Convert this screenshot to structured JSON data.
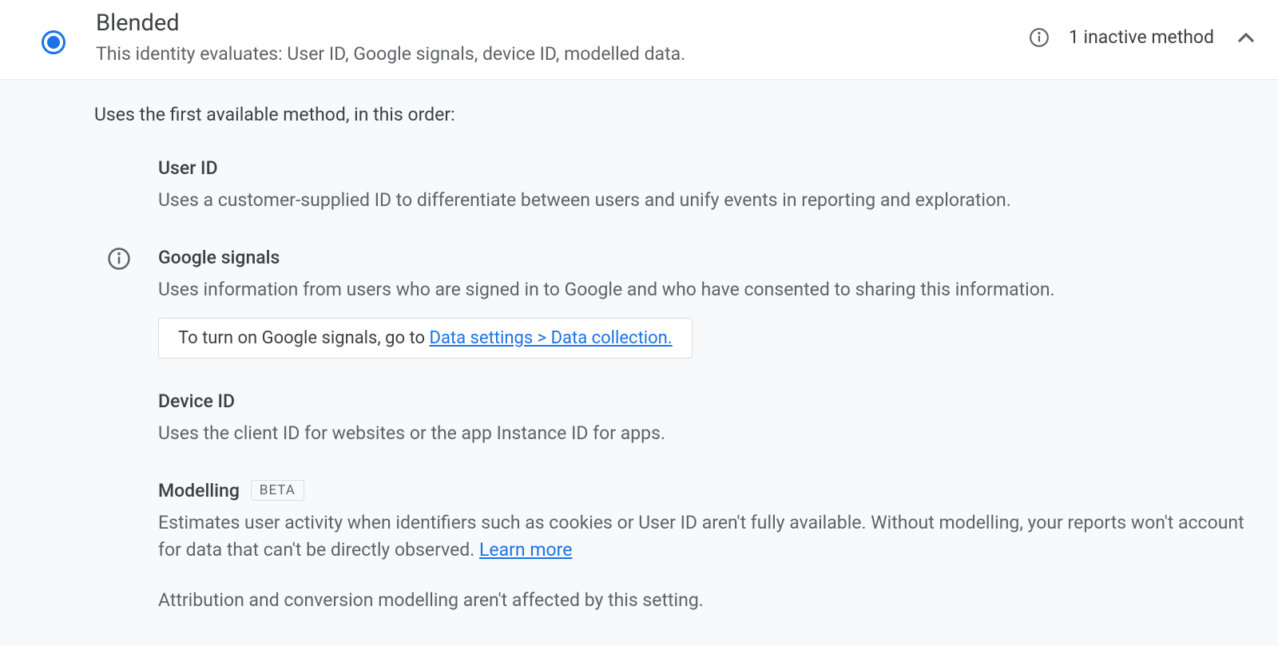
{
  "header": {
    "title": "Blended",
    "subtitle": "This identity evaluates: User ID, Google signals, device ID, modelled data.",
    "inactive_text": "1 inactive method"
  },
  "body": {
    "intro": "Uses the first available method, in this order:",
    "methods": [
      {
        "title": "User ID",
        "desc": "Uses a customer-supplied ID to differentiate between users and unify events in reporting and exploration."
      },
      {
        "title": "Google signals",
        "desc": "Uses information from users who are signed in to Google and who have consented to sharing this information.",
        "callout_prefix": "To turn on Google signals, go to ",
        "callout_link": "Data settings > Data collection."
      },
      {
        "title": "Device ID",
        "desc": "Uses the client ID for websites or the app Instance ID for apps."
      },
      {
        "title": "Modelling",
        "badge": "BETA",
        "desc_prefix": "Estimates user activity when identifiers such as cookies or User ID aren't fully available. Without modelling, your reports won't account for data that can't be directly observed. ",
        "desc_link": "Learn more",
        "note": "Attribution and conversion modelling aren't affected by this setting."
      }
    ]
  }
}
